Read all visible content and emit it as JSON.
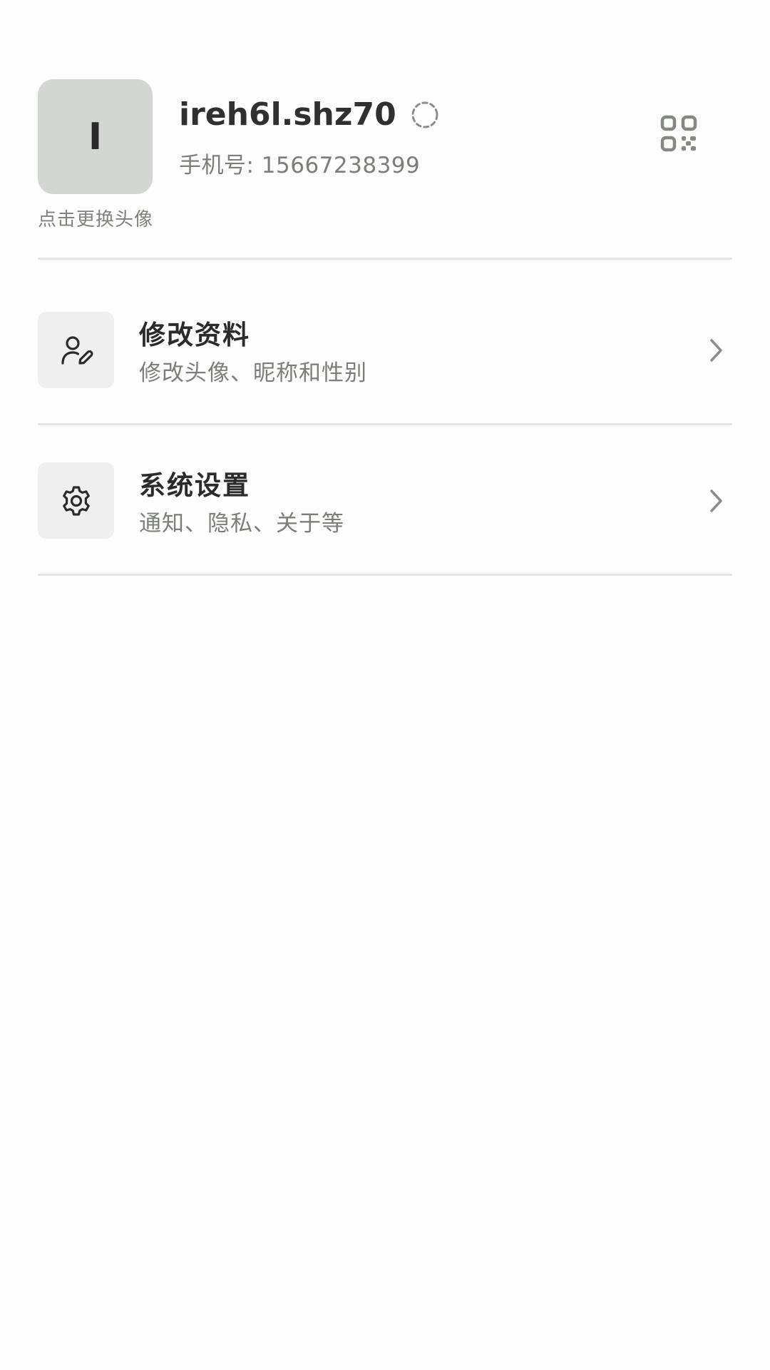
{
  "profile": {
    "avatar_letter": "I",
    "avatar_hint": "点击更换头像",
    "username": "ireh6l.shz70",
    "phone": "手机号: 15667238399"
  },
  "menu": [
    {
      "title": "修改资料",
      "subtitle": "修改头像、昵称和性别",
      "icon": "user-edit-icon"
    },
    {
      "title": "系统设置",
      "subtitle": "通知、隐私、关于等",
      "icon": "gear-icon"
    }
  ],
  "colors": {
    "background": "#fdfdfd",
    "avatar_bg": "#d4d6d3",
    "secondary_text": "#7a8079",
    "primary_text": "#2b2b2b",
    "divider": "#e6e6e6",
    "icon_box_bg": "#efefef"
  }
}
